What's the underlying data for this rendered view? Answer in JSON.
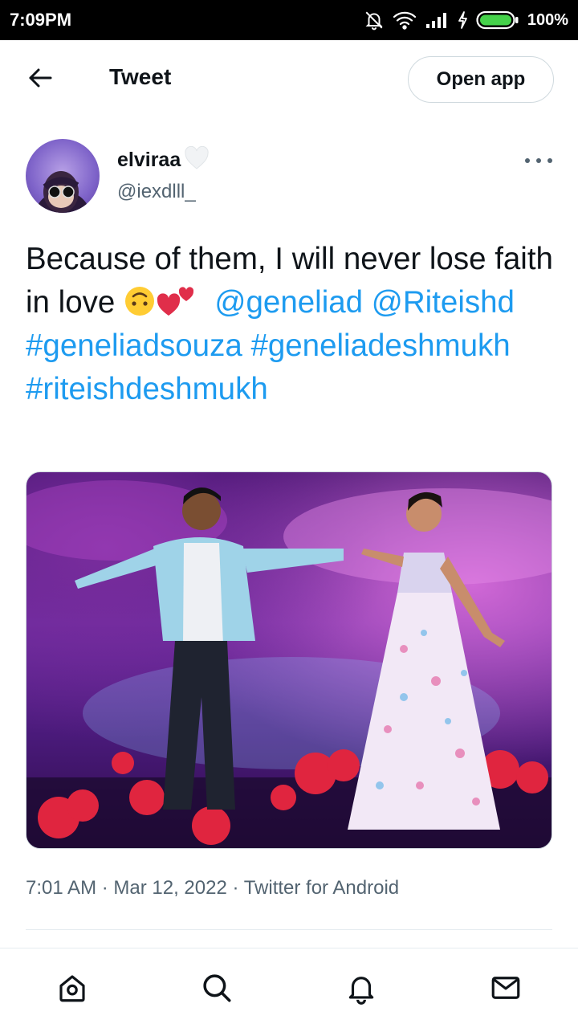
{
  "status_bar": {
    "time": "7:09PM",
    "battery": "100%",
    "icons": [
      "notifications-muted-icon",
      "wifi-icon",
      "signal-icon",
      "charging-icon",
      "battery-icon"
    ]
  },
  "header": {
    "back_icon": "arrow-left-icon",
    "title": "Tweet",
    "open_app_label": "Open app"
  },
  "author": {
    "display_name": "elviraa",
    "name_emoji": "🤍",
    "handle": "@iexdlll_",
    "more_icon": "more-horizontal-icon"
  },
  "tweet": {
    "text_line1": "Because of them, I will never lose faith in love ",
    "emoji_1": "upside-down-face",
    "emoji_2": "two-hearts",
    "mention_1": "@geneliad",
    "mention_2": "@Riteishd",
    "hashtag_1": "#geneliadsouza",
    "hashtag_2": "#geneliadeshmukh",
    "hashtag_3": "#riteishdeshmukh"
  },
  "meta": {
    "text": "7:01 AM · Mar 12, 2022 · Twitter for Android"
  },
  "bottom_nav": {
    "items": [
      "home-icon",
      "search-icon",
      "notifications-icon",
      "messages-icon"
    ]
  },
  "colors": {
    "link": "#1d9bf0",
    "text": "#0f1419",
    "secondary": "#536471"
  }
}
